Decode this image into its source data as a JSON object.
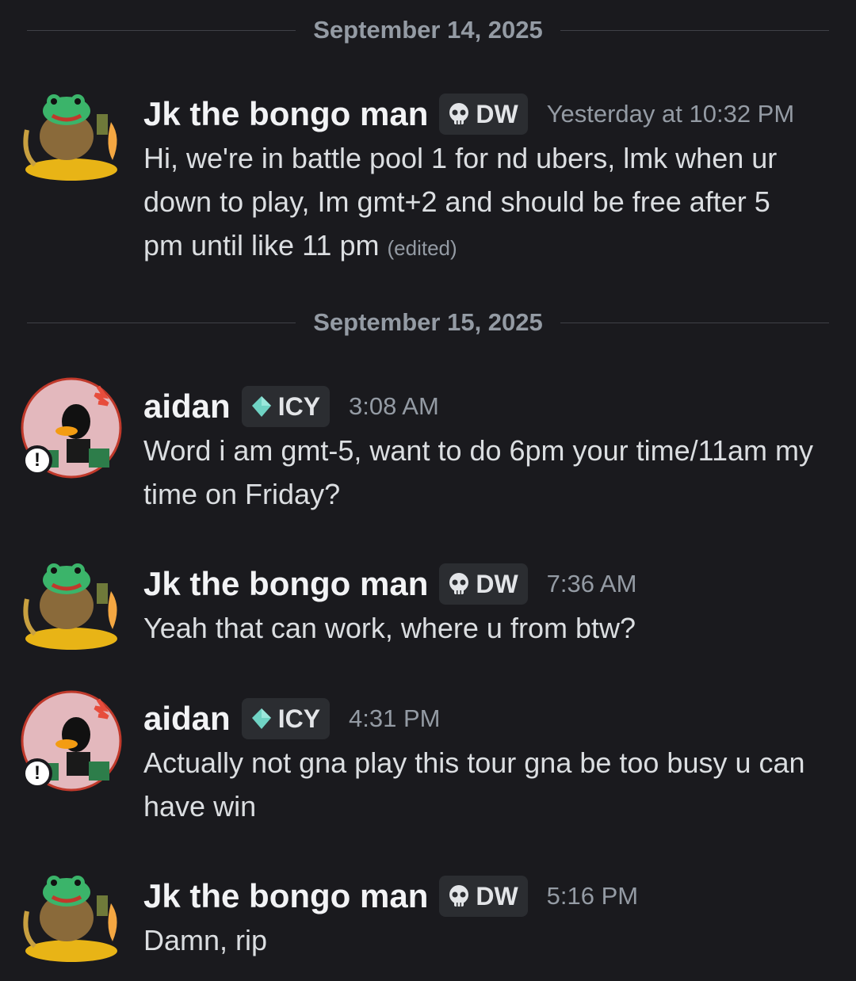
{
  "dividers": [
    "September 14, 2025",
    "September 15, 2025"
  ],
  "users": {
    "jk": {
      "name": "Jk the bongo man",
      "tag": "DW",
      "tag_icon": "skull-icon"
    },
    "aidan": {
      "name": "aidan",
      "tag": "ICY",
      "tag_icon": "gem-icon",
      "status_icon": "alert-status-icon"
    }
  },
  "messages": [
    {
      "user": "jk",
      "time": "Yesterday at 10:32 PM",
      "text": "Hi, we're in battle pool 1 for nd ubers, lmk when ur down to play, Im gmt+2 and should be free after 5 pm until like 11 pm",
      "edited": "(edited)"
    },
    {
      "user": "aidan",
      "time": "3:08 AM",
      "text": "Word i am gmt-5, want to do 6pm your time/11am my time on Friday?"
    },
    {
      "user": "jk",
      "time": "7:36 AM",
      "text": "Yeah that can work, where u from btw?"
    },
    {
      "user": "aidan",
      "time": "4:31 PM",
      "text": "Actually not gna play this tour gna be too busy u can have win"
    },
    {
      "user": "jk",
      "time": "5:16 PM",
      "text": "Damn, rip"
    }
  ],
  "colors": {
    "background": "#1a1a1e",
    "text": "#dbdee1",
    "muted": "#949ba4",
    "tag_bg": "#2b2d31"
  }
}
